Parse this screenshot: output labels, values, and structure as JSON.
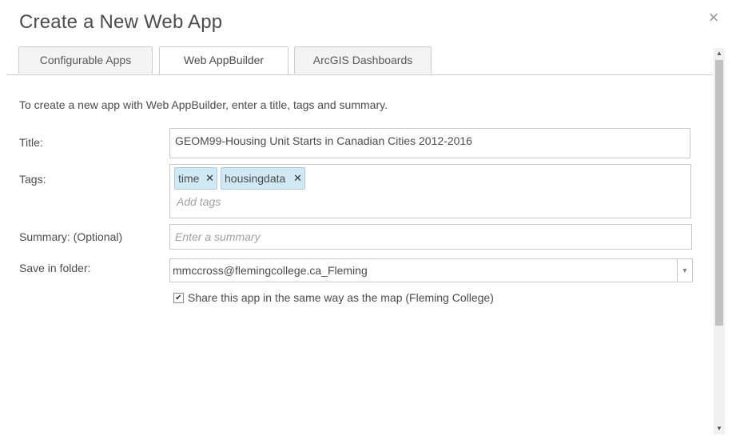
{
  "dialog": {
    "title": "Create a New Web App",
    "close_icon": "close-icon"
  },
  "tabs": [
    {
      "label": "Configurable Apps",
      "active": false
    },
    {
      "label": "Web AppBuilder",
      "active": true
    },
    {
      "label": "ArcGIS Dashboards",
      "active": false
    }
  ],
  "form": {
    "intro": "To create a new app with Web AppBuilder, enter a title, tags and summary.",
    "title_label": "Title:",
    "title_value": "GEOM99-Housing Unit Starts in Canadian Cities 2012-2016",
    "tags_label": "Tags:",
    "tags": [
      {
        "label": "time"
      },
      {
        "label": "housingdata"
      }
    ],
    "tags_remove_glyph": "✕",
    "tags_placeholder": "Add tags",
    "summary_label": "Summary: (Optional)",
    "summary_placeholder": "Enter a summary",
    "folder_label": "Save in folder:",
    "folder_value": "mmccross@flemingcollege.ca_Fleming",
    "share_checked": true,
    "share_label": "Share this app in the same way as the map (Fleming College)"
  },
  "colors": {
    "tag_bg": "#d1e9f5",
    "border": "#c9c9c9",
    "text": "#4c4c4c"
  }
}
